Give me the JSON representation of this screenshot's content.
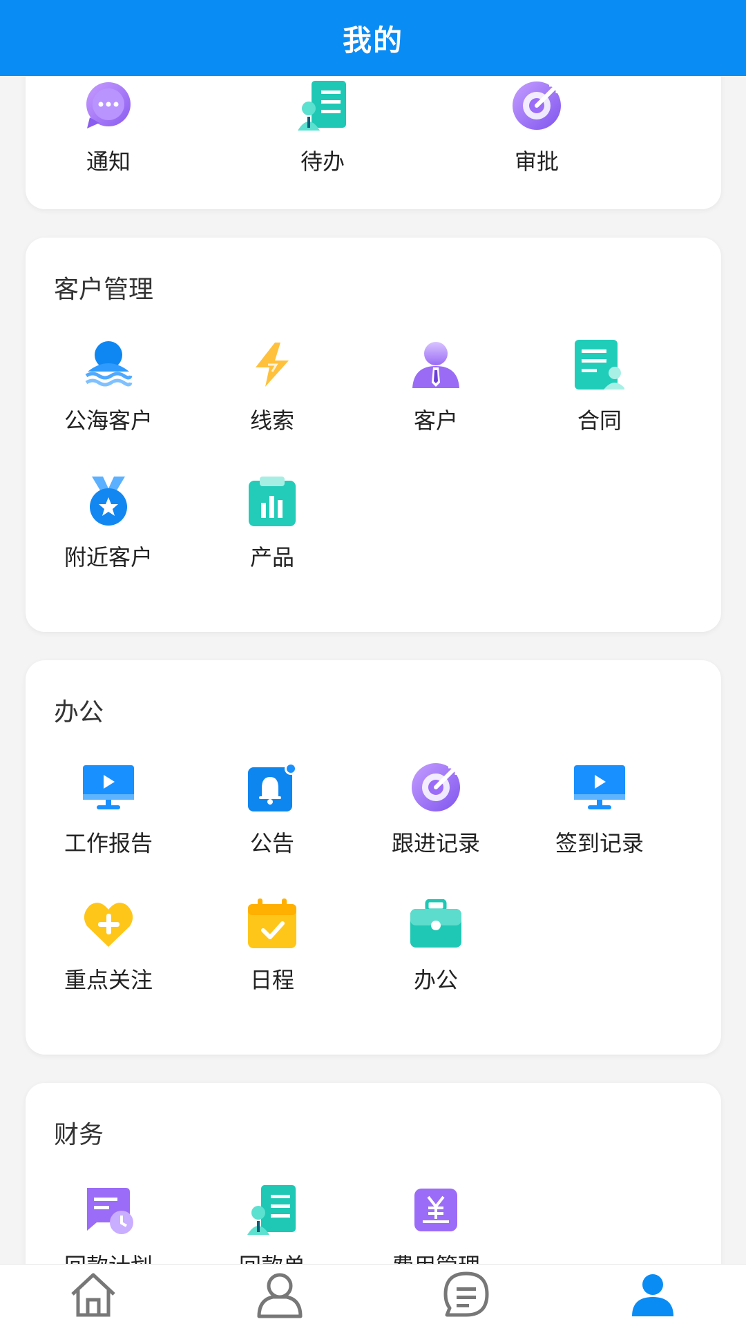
{
  "header": {
    "title": "我的"
  },
  "quick": {
    "items": [
      {
        "label": "通知",
        "icon": "chat-bubble-icon"
      },
      {
        "label": "待办",
        "icon": "todo-list-icon"
      },
      {
        "label": "审批",
        "icon": "target-icon"
      }
    ]
  },
  "customer": {
    "title": "客户管理",
    "items": [
      {
        "label": "公海客户",
        "icon": "public-sea-customer-icon"
      },
      {
        "label": "线索",
        "icon": "lightning-icon"
      },
      {
        "label": "客户",
        "icon": "customer-icon"
      },
      {
        "label": "合同",
        "icon": "contract-icon"
      },
      {
        "label": "附近客户",
        "icon": "medal-icon"
      },
      {
        "label": "产品",
        "icon": "product-chart-icon"
      }
    ]
  },
  "office": {
    "title": "办公",
    "items": [
      {
        "label": "工作报告",
        "icon": "monitor-play-icon"
      },
      {
        "label": "公告",
        "icon": "bell-icon"
      },
      {
        "label": "跟进记录",
        "icon": "target-icon"
      },
      {
        "label": "签到记录",
        "icon": "monitor-play-icon"
      },
      {
        "label": "重点关注",
        "icon": "heart-plus-icon"
      },
      {
        "label": "日程",
        "icon": "calendar-check-icon"
      },
      {
        "label": "办公",
        "icon": "briefcase-icon"
      }
    ]
  },
  "finance": {
    "title": "财务",
    "items": [
      {
        "label": "回款计划",
        "icon": "payment-plan-icon"
      },
      {
        "label": "回款单",
        "icon": "receipt-list-icon"
      },
      {
        "label": "费用管理",
        "icon": "yuan-icon"
      }
    ]
  },
  "tabbar": {
    "tabs": [
      {
        "name": "home",
        "icon": "home-icon",
        "active": false
      },
      {
        "name": "contacts",
        "icon": "person-icon",
        "active": false
      },
      {
        "name": "messages",
        "icon": "message-icon",
        "active": false
      },
      {
        "name": "mine",
        "icon": "user-icon",
        "active": true
      }
    ]
  },
  "colors": {
    "primary": "#0a8cf5",
    "background": "#f4f4f4",
    "card": "#ffffff"
  }
}
